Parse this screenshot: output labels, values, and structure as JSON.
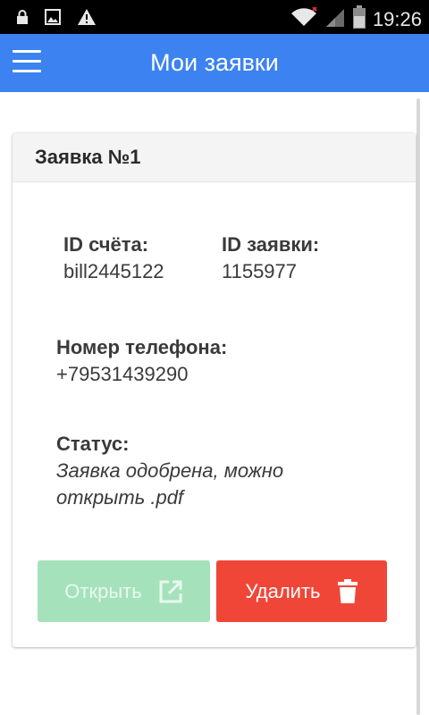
{
  "status_bar": {
    "time": "19:26",
    "icons": [
      "lock-icon",
      "image-icon",
      "warning-icon",
      "wifi-icon",
      "signal-icon",
      "battery-icon"
    ]
  },
  "app_bar": {
    "title": "Мои заявки",
    "menu_icon": "menu-icon",
    "color": "#3c82f0"
  },
  "card": {
    "title": "Заявка №1",
    "bill_id": {
      "label": "ID счёта:",
      "value": "bill2445122"
    },
    "request_id": {
      "label": "ID заявки:",
      "value": "1155977"
    },
    "phone": {
      "label": "Номер телефона:",
      "value": "+79531439290"
    },
    "status": {
      "label": "Статус:",
      "value_line1": "Заявка одобрена, можно",
      "value_line2": "открыть .pdf"
    },
    "buttons": {
      "open": {
        "label": "Открыть",
        "icon": "open-external-icon",
        "color": "#a5e2bb"
      },
      "delete": {
        "label": "Удалить",
        "icon": "trash-icon",
        "color": "#f04638"
      }
    }
  }
}
